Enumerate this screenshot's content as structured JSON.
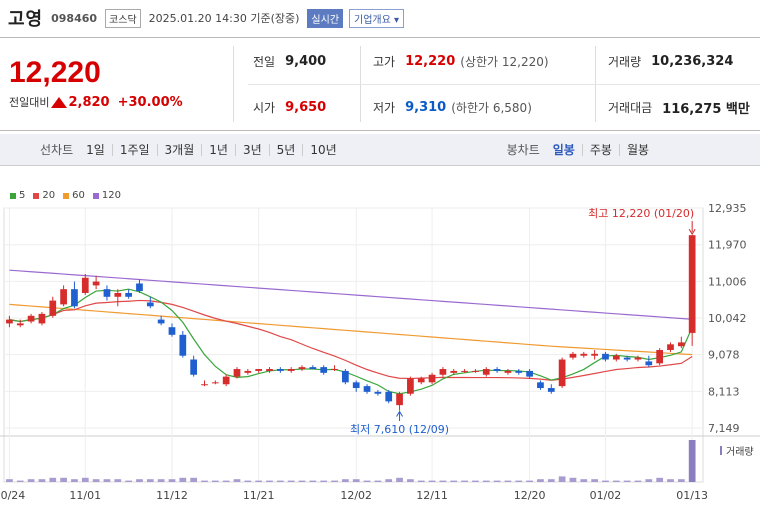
{
  "header": {
    "name": "고영",
    "code": "098460",
    "market": "코스닥",
    "datetime": "2025.01.20 14:30 기준(장중)",
    "realtime_btn": "실시간",
    "info_btn": "기업개요 ▾"
  },
  "summary": {
    "price": "12,220",
    "change_label": "전일대비",
    "change": "2,820",
    "change_pct": "+30.00%",
    "prev_close_label": "전일",
    "prev_close": "9,400",
    "high_label": "고가",
    "high": "12,220",
    "upper_limit": "(상한가 12,220)",
    "volume_label": "거래량",
    "volume": "10,236,324",
    "open_label": "시가",
    "open": "9,650",
    "low_label": "저가",
    "low": "9,310",
    "lower_limit": "(하한가 6,580)",
    "amount_label": "거래대금",
    "amount": "116,275 백만"
  },
  "periods": {
    "line_label": "선차트",
    "line": [
      "1일",
      "1주일",
      "3개월",
      "1년",
      "3년",
      "5년",
      "10년"
    ],
    "candle_label": "봉차트",
    "candle": [
      "일봉",
      "주봉",
      "월봉"
    ],
    "candle_active": 0
  },
  "legend": [
    {
      "label": "5",
      "color": "#3aa53a"
    },
    {
      "label": "20",
      "color": "#e04848"
    },
    {
      "label": "60",
      "color": "#f09a30"
    },
    {
      "label": "120",
      "color": "#9a6ad0"
    }
  ],
  "colors": {
    "up": "#d62c2c",
    "down": "#1f5fcf",
    "volume": "#a79bcf",
    "volume_last": "#8c7cc0"
  },
  "chart_data": {
    "type": "candlestick",
    "y_ticks": [
      "12,935",
      "11,970",
      "11,006",
      "10,042",
      "9,078",
      "8,113",
      "7,149"
    ],
    "ylim": [
      7149,
      12935
    ],
    "x_ticks": [
      "10/24",
      "11/01",
      "11/12",
      "11/21",
      "12/02",
      "12/11",
      "12/20",
      "01/02",
      "01/13"
    ],
    "annotations": {
      "high": "최고 12,220 (01/20)",
      "low": "최저 7,610 (12/09)"
    },
    "volume_label": "거래량",
    "candles": [
      {
        "o": 9900,
        "h": 10100,
        "l": 9800,
        "c": 10000
      },
      {
        "o": 9850,
        "h": 10000,
        "l": 9800,
        "c": 9900
      },
      {
        "o": 9950,
        "h": 10150,
        "l": 9900,
        "c": 10100
      },
      {
        "o": 9900,
        "h": 10200,
        "l": 9850,
        "c": 10150
      },
      {
        "o": 10100,
        "h": 10600,
        "l": 10050,
        "c": 10500
      },
      {
        "o": 10400,
        "h": 10900,
        "l": 10350,
        "c": 10800
      },
      {
        "o": 10800,
        "h": 11000,
        "l": 10300,
        "c": 10350
      },
      {
        "o": 10700,
        "h": 11200,
        "l": 10650,
        "c": 11100
      },
      {
        "o": 10900,
        "h": 11150,
        "l": 10800,
        "c": 11000
      },
      {
        "o": 10800,
        "h": 10900,
        "l": 10500,
        "c": 10600
      },
      {
        "o": 10600,
        "h": 10800,
        "l": 10350,
        "c": 10700
      },
      {
        "o": 10700,
        "h": 10800,
        "l": 10550,
        "c": 10600
      },
      {
        "o": 10950,
        "h": 11050,
        "l": 10700,
        "c": 10750
      },
      {
        "o": 10450,
        "h": 10600,
        "l": 10300,
        "c": 10350
      },
      {
        "o": 10000,
        "h": 10100,
        "l": 9850,
        "c": 9900
      },
      {
        "o": 9800,
        "h": 9900,
        "l": 9550,
        "c": 9600
      },
      {
        "o": 9600,
        "h": 9700,
        "l": 9000,
        "c": 9050
      },
      {
        "o": 8950,
        "h": 9050,
        "l": 8500,
        "c": 8550
      },
      {
        "o": 8300,
        "h": 8400,
        "l": 8250,
        "c": 8300
      },
      {
        "o": 8350,
        "h": 8400,
        "l": 8300,
        "c": 8350
      },
      {
        "o": 8300,
        "h": 8550,
        "l": 8250,
        "c": 8500
      },
      {
        "o": 8500,
        "h": 8750,
        "l": 8450,
        "c": 8700
      },
      {
        "o": 8600,
        "h": 8700,
        "l": 8550,
        "c": 8650
      },
      {
        "o": 8650,
        "h": 8700,
        "l": 8600,
        "c": 8700
      },
      {
        "o": 8650,
        "h": 8750,
        "l": 8600,
        "c": 8700
      },
      {
        "o": 8700,
        "h": 8750,
        "l": 8600,
        "c": 8650
      },
      {
        "o": 8650,
        "h": 8750,
        "l": 8600,
        "c": 8700
      },
      {
        "o": 8700,
        "h": 8800,
        "l": 8650,
        "c": 8750
      },
      {
        "o": 8750,
        "h": 8800,
        "l": 8700,
        "c": 8700
      },
      {
        "o": 8750,
        "h": 8800,
        "l": 8550,
        "c": 8600
      },
      {
        "o": 8700,
        "h": 8800,
        "l": 8650,
        "c": 8700
      },
      {
        "o": 8650,
        "h": 8700,
        "l": 8300,
        "c": 8350
      },
      {
        "o": 8350,
        "h": 8400,
        "l": 8100,
        "c": 8200
      },
      {
        "o": 8250,
        "h": 8300,
        "l": 8050,
        "c": 8100
      },
      {
        "o": 8100,
        "h": 8150,
        "l": 8000,
        "c": 8050
      },
      {
        "o": 8100,
        "h": 8150,
        "l": 7800,
        "c": 7850
      },
      {
        "o": 7750,
        "h": 8100,
        "l": 7610,
        "c": 8050
      },
      {
        "o": 8050,
        "h": 8500,
        "l": 8000,
        "c": 8450
      },
      {
        "o": 8350,
        "h": 8500,
        "l": 8300,
        "c": 8450
      },
      {
        "o": 8350,
        "h": 8600,
        "l": 8300,
        "c": 8550
      },
      {
        "o": 8550,
        "h": 8750,
        "l": 8500,
        "c": 8700
      },
      {
        "o": 8600,
        "h": 8700,
        "l": 8550,
        "c": 8650
      },
      {
        "o": 8650,
        "h": 8700,
        "l": 8600,
        "c": 8650
      },
      {
        "o": 8650,
        "h": 8700,
        "l": 8600,
        "c": 8650
      },
      {
        "o": 8550,
        "h": 8750,
        "l": 8500,
        "c": 8700
      },
      {
        "o": 8700,
        "h": 8750,
        "l": 8600,
        "c": 8650
      },
      {
        "o": 8600,
        "h": 8700,
        "l": 8550,
        "c": 8650
      },
      {
        "o": 8650,
        "h": 8700,
        "l": 8550,
        "c": 8600
      },
      {
        "o": 8650,
        "h": 8700,
        "l": 8450,
        "c": 8500
      },
      {
        "o": 8350,
        "h": 8400,
        "l": 8150,
        "c": 8200
      },
      {
        "o": 8200,
        "h": 8300,
        "l": 8050,
        "c": 8100
      },
      {
        "o": 8250,
        "h": 9000,
        "l": 8200,
        "c": 8950
      },
      {
        "o": 9000,
        "h": 9150,
        "l": 8950,
        "c": 9100
      },
      {
        "o": 9050,
        "h": 9150,
        "l": 9000,
        "c": 9100
      },
      {
        "o": 9050,
        "h": 9200,
        "l": 8950,
        "c": 9100
      },
      {
        "o": 9100,
        "h": 9150,
        "l": 8900,
        "c": 8950
      },
      {
        "o": 8950,
        "h": 9100,
        "l": 8900,
        "c": 9050
      },
      {
        "o": 9000,
        "h": 9050,
        "l": 8900,
        "c": 8950
      },
      {
        "o": 8950,
        "h": 9050,
        "l": 8900,
        "c": 9000
      },
      {
        "o": 8900,
        "h": 9050,
        "l": 8750,
        "c": 8800
      },
      {
        "o": 8850,
        "h": 9250,
        "l": 8800,
        "c": 9200
      },
      {
        "o": 9200,
        "h": 9400,
        "l": 9150,
        "c": 9350
      },
      {
        "o": 9300,
        "h": 9550,
        "l": 9250,
        "c": 9400
      },
      {
        "o": 9650,
        "h": 12220,
        "l": 9310,
        "c": 12220
      }
    ],
    "volumes": [
      2,
      1,
      2,
      2,
      3,
      3,
      2,
      3,
      2,
      2,
      2,
      1,
      2,
      2,
      2,
      2,
      3,
      3,
      1,
      1,
      1,
      2,
      1,
      1,
      1,
      1,
      1,
      1,
      1,
      1,
      1,
      2,
      2,
      1,
      1,
      2,
      3,
      2,
      1,
      1,
      1,
      1,
      1,
      1,
      1,
      1,
      1,
      1,
      1,
      2,
      2,
      4,
      3,
      2,
      2,
      1,
      1,
      1,
      1,
      2,
      3,
      2,
      2,
      30
    ]
  }
}
